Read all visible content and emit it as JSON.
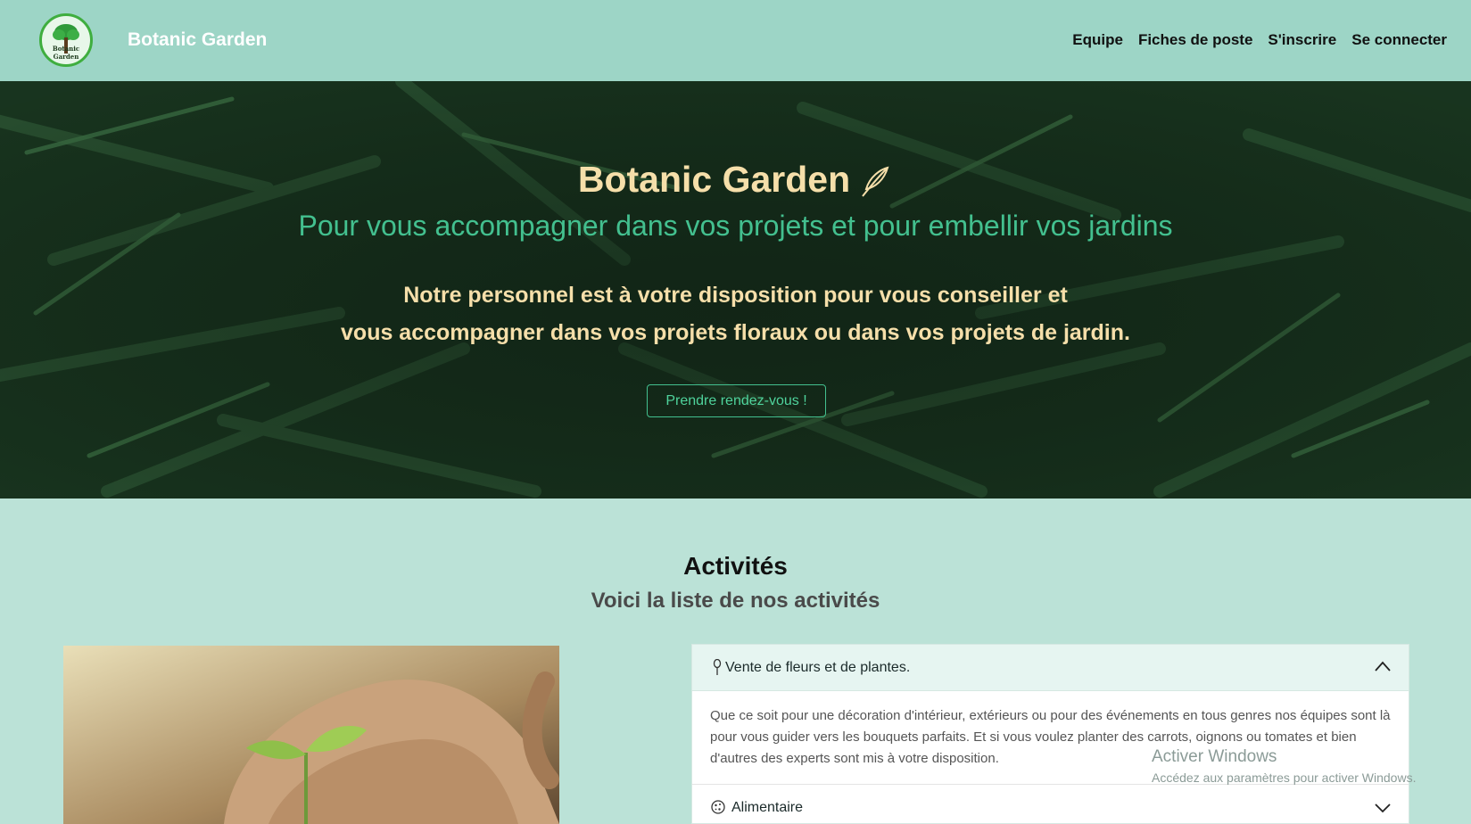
{
  "navbar": {
    "logo_text": "Botanic Garden",
    "brand": "Botanic Garden",
    "links": [
      "Equipe",
      "Fiches de poste",
      "S'inscrire",
      "Se connecter"
    ]
  },
  "hero": {
    "title": "Botanic Garden",
    "subtitle": "Pour vous accompagner dans vos projets et pour embellir vos jardins",
    "text_line1": "Notre personnel est à votre disposition pour vous conseiller et",
    "text_line2": "vous accompagner dans vos projets floraux ou dans vos projets de jardin.",
    "button": "Prendre rendez-vous !"
  },
  "activities": {
    "title": "Activités",
    "subtitle": "Voici la liste de nos activités",
    "accordion": [
      {
        "label": "Vente de fleurs et de plantes.",
        "icon": "flower-icon",
        "expanded": true,
        "body": "Que ce soit pour une décoration d'intérieur, extérieurs ou pour des événements en tous genres nos équipes sont là pour vous guider vers les bouquets parfaits. Et si vous voulez planter des carrots, oignons ou tomates et bien d'autres des experts sont mis à votre disposition."
      },
      {
        "label": "Alimentaire",
        "icon": "cookie-icon",
        "expanded": false
      }
    ]
  },
  "watermark": {
    "title": "Activer Windows",
    "subtitle": "Accédez aux paramètres pour activer Windows."
  },
  "colors": {
    "navbar": "#9dd5c6",
    "page_bg": "#bbe2d7",
    "hero_title": "#f6dfaa",
    "hero_subtitle": "#43c08f"
  }
}
